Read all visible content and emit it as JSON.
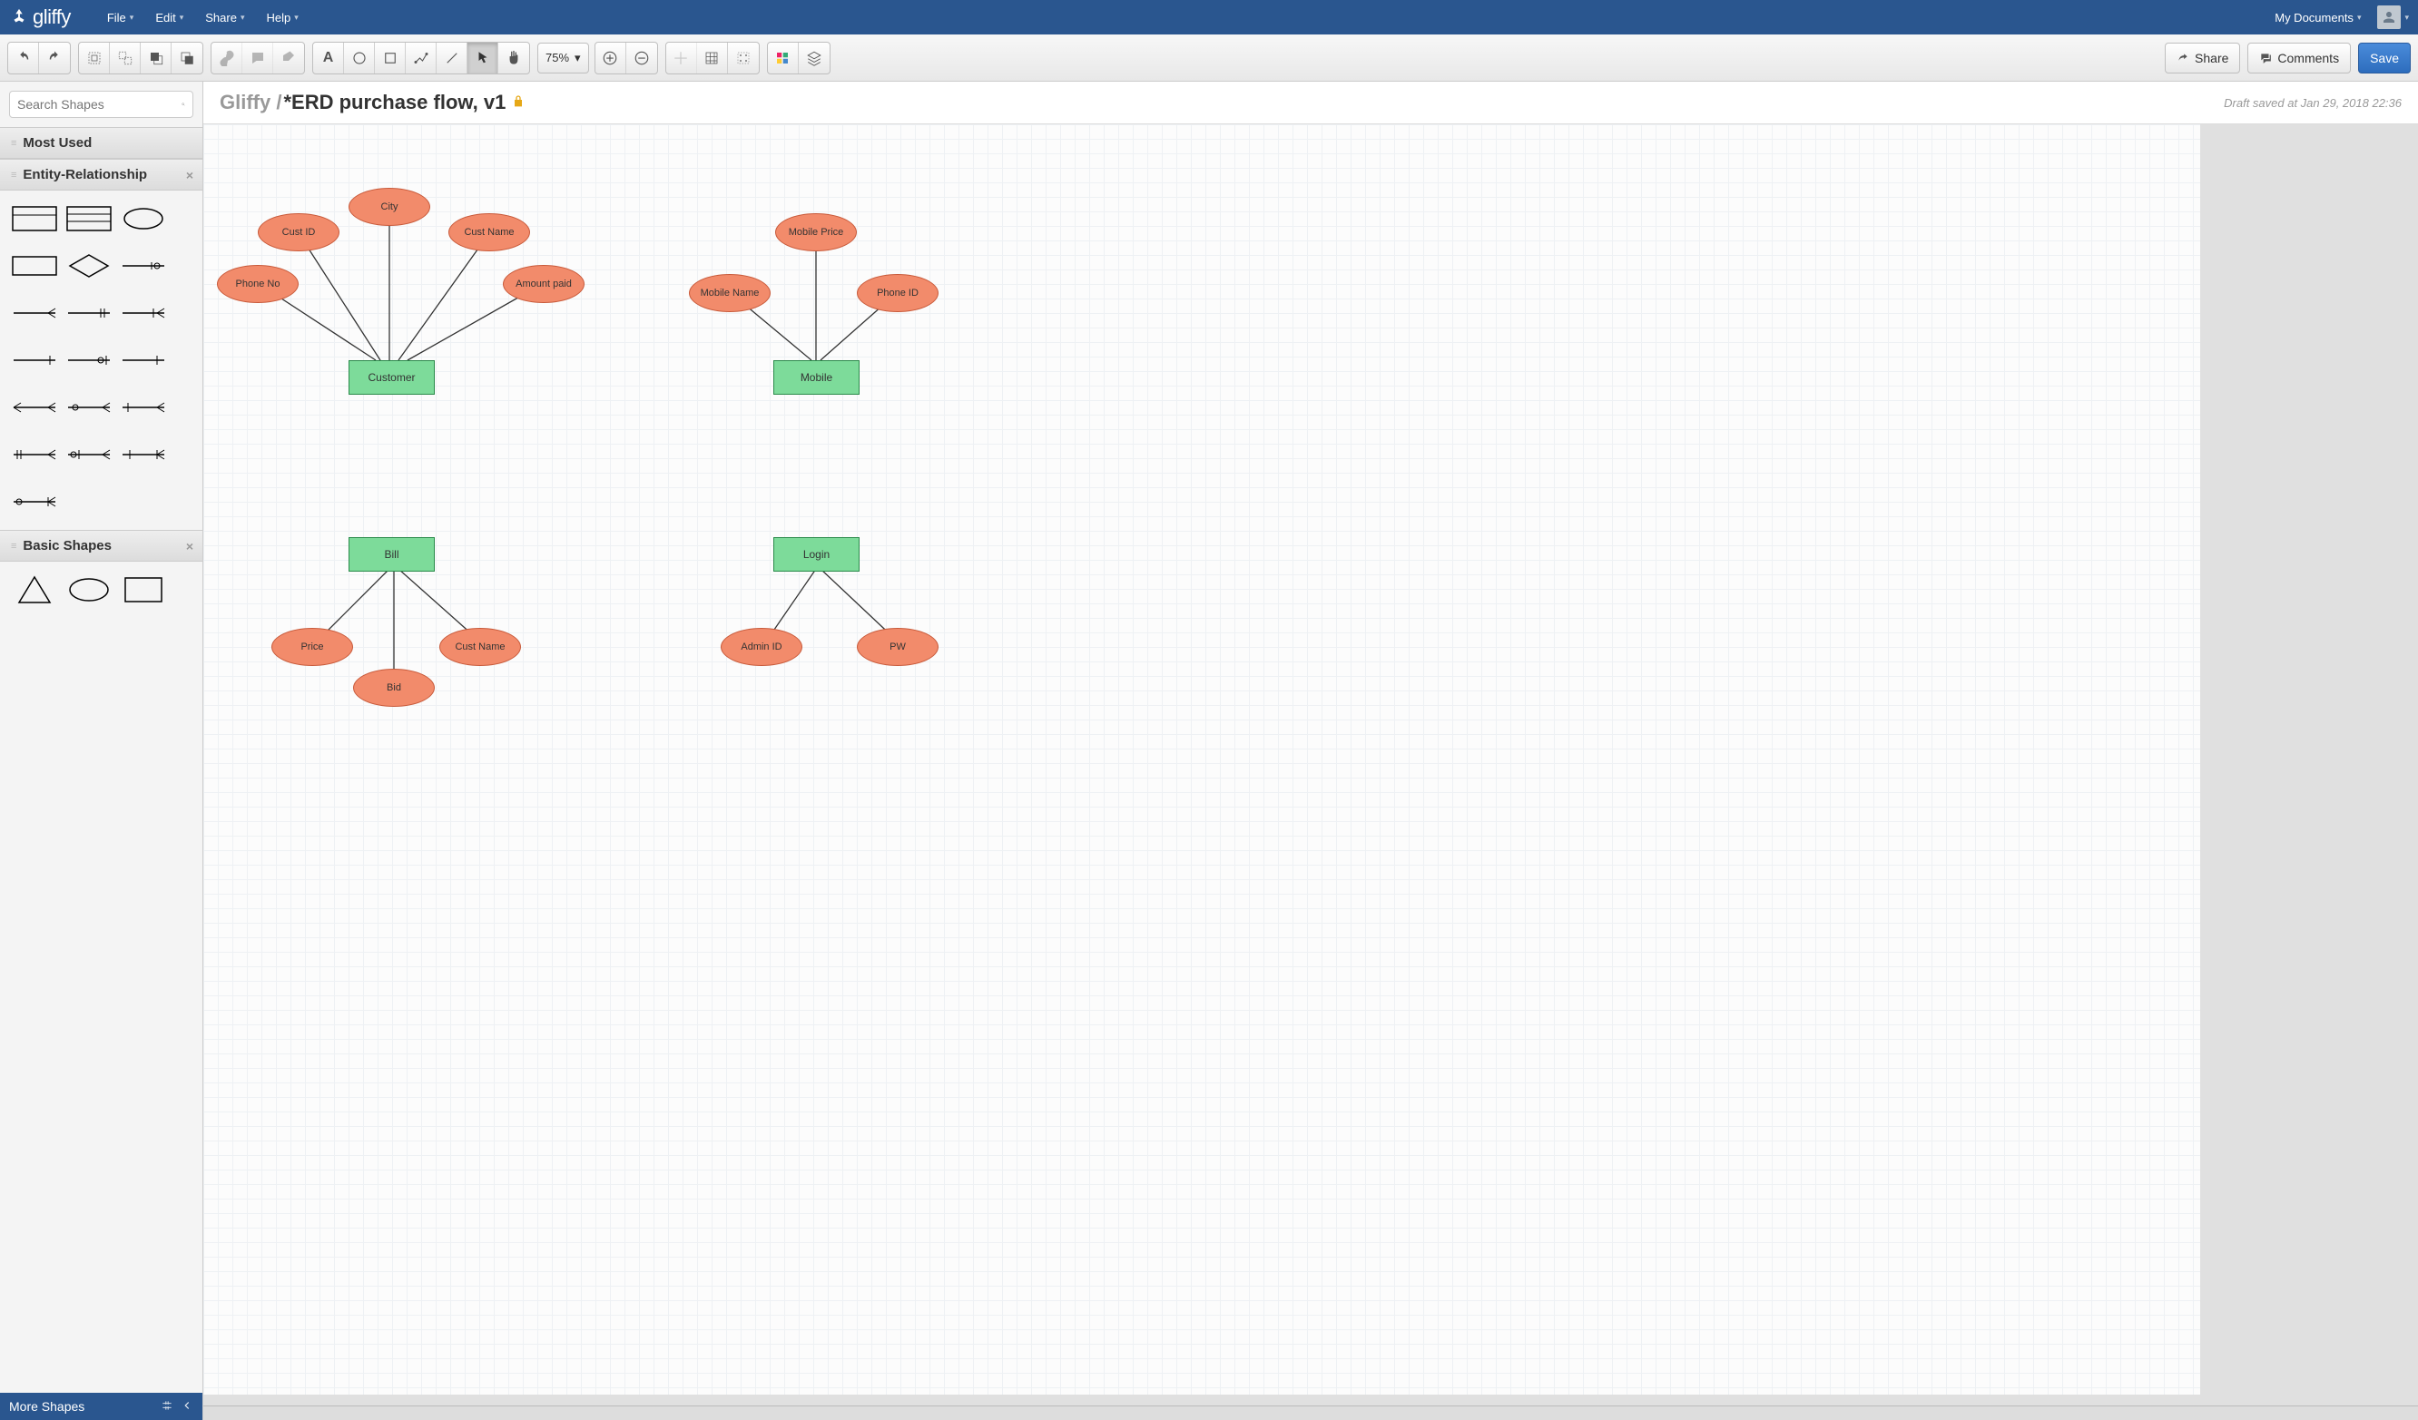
{
  "app": {
    "name": "gliffy"
  },
  "topnav": {
    "menus": [
      "File",
      "Edit",
      "Share",
      "Help"
    ],
    "my_documents": "My Documents"
  },
  "toolbar": {
    "zoom": "75%",
    "share": "Share",
    "comments": "Comments",
    "save": "Save"
  },
  "sidebar": {
    "search_placeholder": "Search Shapes",
    "sections": {
      "most_used": "Most Used",
      "er": "Entity-Relationship",
      "basic": "Basic Shapes"
    },
    "footer": {
      "more_shapes": "More Shapes"
    }
  },
  "document": {
    "breadcrumb": "Gliffy /",
    "title": "*ERD purchase flow, v1",
    "status": "Draft saved at Jan 29, 2018 22:36"
  },
  "diagram": {
    "entities": {
      "customer": "Customer",
      "mobile": "Mobile",
      "bill": "Bill",
      "login": "Login"
    },
    "attributes": {
      "phone_no": "Phone No",
      "cust_id": "Cust ID",
      "city": "City",
      "cust_name_1": "Cust Name",
      "amount_paid": "Amount paid",
      "mobile_name": "Mobile Name",
      "mobile_price": "Mobile Price",
      "phone_id": "Phone ID",
      "price": "Price",
      "bid": "Bid",
      "cust_name_2": "Cust Name",
      "admin_id": "Admin ID",
      "pw": "PW"
    }
  }
}
